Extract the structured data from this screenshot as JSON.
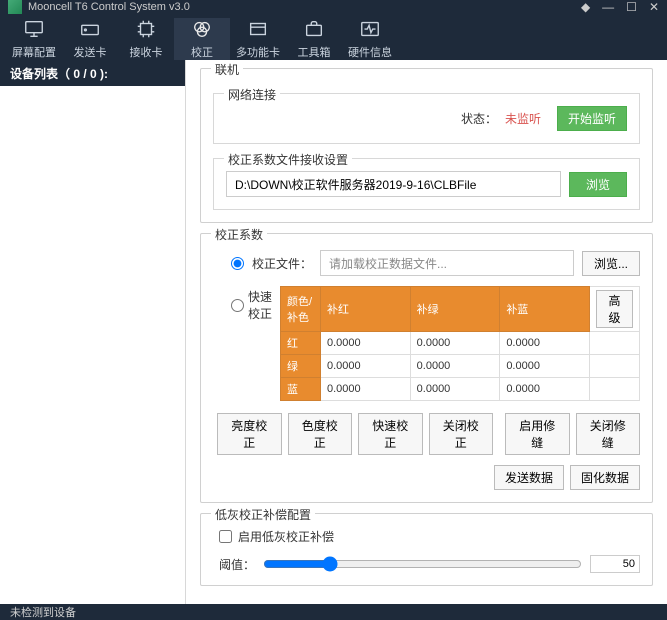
{
  "titlebar": {
    "title": "Mooncell T6 Control System v3.0"
  },
  "toolbar": {
    "items": [
      {
        "label": "屏幕配置"
      },
      {
        "label": "发送卡"
      },
      {
        "label": "接收卡"
      },
      {
        "label": "校正"
      },
      {
        "label": "多功能卡"
      },
      {
        "label": "工具箱"
      },
      {
        "label": "硬件信息"
      }
    ]
  },
  "sidebar": {
    "title": "设备列表（ 0 / 0 ):"
  },
  "lianji": {
    "title": "联机",
    "net_title": "网络连接",
    "status_label": "状态：",
    "status_value": "未监听",
    "start_listen": "开始监听",
    "recv_title": "校正系数文件接收设置",
    "path": "D:\\DOWN\\校正软件服务器2019-9-16\\CLBFile",
    "browse": "浏览"
  },
  "coeff": {
    "title": "校正系数",
    "file_radio": "校正文件：",
    "file_placeholder": "请加载校正数据文件...",
    "browse": "浏览...",
    "quick_radio": "快速校正",
    "advanced": "高级",
    "headers": {
      "c0": "颜色/补色",
      "c1": "补红",
      "c2": "补绿",
      "c3": "补蓝"
    },
    "rows": [
      {
        "h": "红",
        "v": [
          "0.0000",
          "0.0000",
          "0.0000"
        ]
      },
      {
        "h": "绿",
        "v": [
          "0.0000",
          "0.0000",
          "0.0000"
        ]
      },
      {
        "h": "蓝",
        "v": [
          "0.0000",
          "0.0000",
          "0.0000"
        ]
      }
    ],
    "btns": {
      "bright": "亮度校正",
      "chroma": "色度校正",
      "quick": "快速校正",
      "close_cal": "关闭校正",
      "enable_fix": "启用修缝",
      "close_fix": "关闭修缝",
      "send": "发送数据",
      "solidify": "固化数据"
    }
  },
  "lowgray": {
    "title": "低灰校正补偿配置",
    "enable": "启用低灰校正补偿",
    "threshold_label": "阈值：",
    "threshold_value": "50"
  },
  "statusbar": {
    "text": "未检测到设备"
  }
}
